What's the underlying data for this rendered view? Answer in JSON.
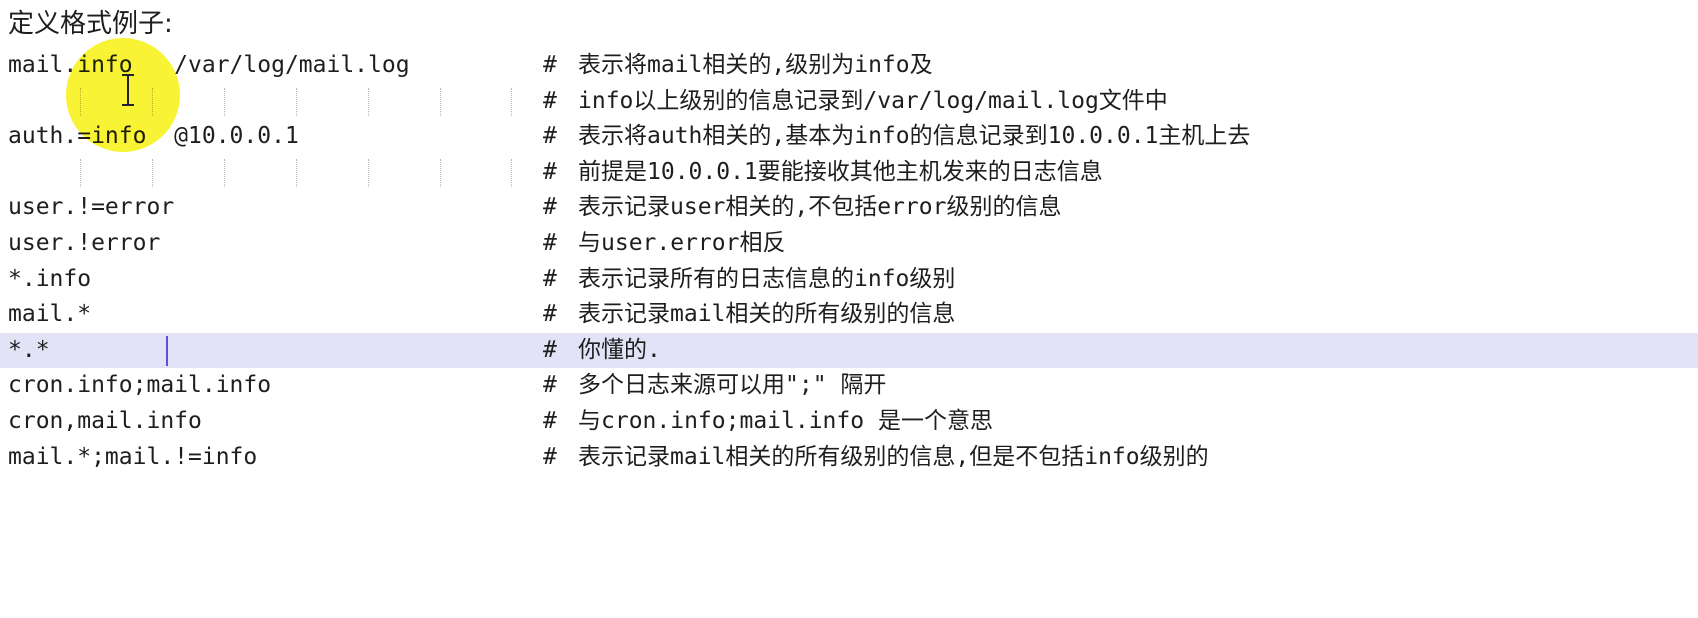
{
  "heading": "定义格式例子:",
  "lines": [
    {
      "code": "mail.info   /var/log/mail.log",
      "hash": "#",
      "comment": "表示将mail相关的,级别为info及"
    },
    {
      "code": "",
      "hash": "#",
      "comment": "info以上级别的信息记录到/var/log/mail.log文件中"
    },
    {
      "code": "auth.=info  @10.0.0.1",
      "hash": "#",
      "comment": "表示将auth相关的,基本为info的信息记录到10.0.0.1主机上去"
    },
    {
      "code": "",
      "hash": "#",
      "comment": "前提是10.0.0.1要能接收其他主机发来的日志信息"
    },
    {
      "code": "user.!=error",
      "hash": "#",
      "comment": "表示记录user相关的,不包括error级别的信息"
    },
    {
      "code": "user.!error",
      "hash": "#",
      "comment": "与user.error相反"
    },
    {
      "code": "*.info",
      "hash": "#",
      "comment": "表示记录所有的日志信息的info级别"
    },
    {
      "code": "mail.*",
      "hash": "#",
      "comment": "表示记录mail相关的所有级别的信息"
    },
    {
      "code": "*.*",
      "hash": "#",
      "comment": "你懂的."
    },
    {
      "code": "cron.info;mail.info",
      "hash": "#",
      "comment": "多个日志来源可以用\";\" 隔开"
    },
    {
      "code": "cron,mail.info",
      "hash": "#",
      "comment": "与cron.info;mail.info 是一个意思"
    },
    {
      "code": "mail.*;mail.!=info",
      "hash": "#",
      "comment": "表示记录mail相关的所有级别的信息,但是不包括info级别的"
    }
  ],
  "current_line_index": 8,
  "colors": {
    "current_line": "#e3e3f7",
    "caret": "#6a4bd6",
    "cursor_highlight": "#f7f211"
  }
}
